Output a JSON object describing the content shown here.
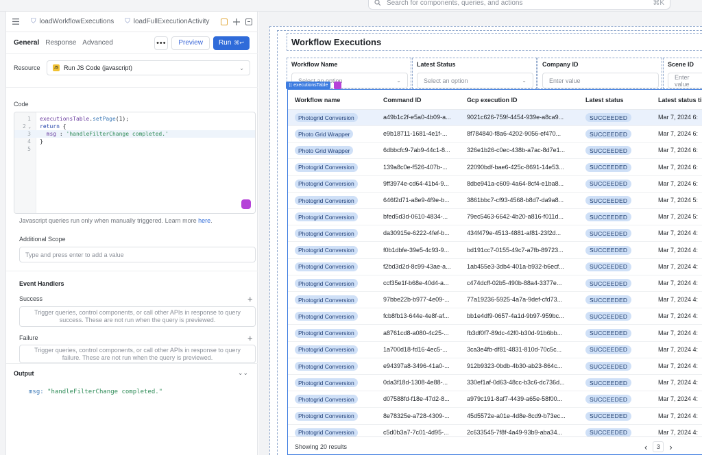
{
  "topbar": {
    "search_placeholder": "Search for components, queries, and actions",
    "search_shortcut": "⌘K"
  },
  "query_tabs": [
    {
      "label": "loadWorkflowExecutions"
    },
    {
      "label": "loadFullExecutionActivity"
    }
  ],
  "subtabs": {
    "general": "General",
    "response": "Response",
    "advanced": "Advanced",
    "more": "•••",
    "preview": "Preview",
    "run": "Run",
    "run_shortcut": "⌘↩"
  },
  "resource": {
    "label": "Resource",
    "value": "Run JS Code (javascript)",
    "badge": "JS"
  },
  "code": {
    "label": "Code",
    "lines": [
      {
        "n": "1",
        "text": "executionsTable.setPage(1);"
      },
      {
        "n": "2",
        "text": "return {"
      },
      {
        "n": "3",
        "text": "  msg : 'handleFilterChange completed.'"
      },
      {
        "n": "4",
        "text": "}"
      },
      {
        "n": "5",
        "text": ""
      }
    ]
  },
  "hint": {
    "text": "Javascript queries run only when manually triggered. Learn more ",
    "link": "here",
    "end": "."
  },
  "additional_scope": {
    "label": "Additional Scope",
    "placeholder": "Type and press enter to add a value"
  },
  "event_handlers": {
    "title": "Event Handlers",
    "success_label": "Success",
    "success_text": "Trigger queries, control components, or call other APIs in response to query success. These are not run when the query is previewed.",
    "failure_label": "Failure",
    "failure_text": "Trigger queries, control components, or call other APIs in response to query failure. These are not run when the query is previewed."
  },
  "output": {
    "label": "Output",
    "key": "msg:",
    "value": " \"handleFilterChange completed.\""
  },
  "canvas": {
    "title": "Workflow Executions",
    "table_tag": "executionsTable",
    "filters": [
      {
        "label": "Workflow Name",
        "placeholder": "Select an option",
        "type": "select"
      },
      {
        "label": "Latest Status",
        "placeholder": "Select an option",
        "type": "select"
      },
      {
        "label": "Company ID",
        "placeholder": "Enter value",
        "type": "input"
      },
      {
        "label": "Scene ID",
        "placeholder": "Enter value",
        "type": "input"
      }
    ],
    "columns": [
      "Workflow name",
      "Command ID",
      "Gcp execution ID",
      "Latest status",
      "Latest status ti"
    ],
    "rows": [
      {
        "workflow": "Photogrid Conversion",
        "command": "a49b1c2f-e5a0-4b09-a...",
        "gcp": "9021c626-759f-4454-939e-a8ca9...",
        "status": "SUCCEEDED",
        "time": "Mar 7, 2024 6:"
      },
      {
        "workflow": "Photo Grid Wrapper",
        "command": "e9b18711-1681-4e1f-...",
        "gcp": "8f784840-f8a6-4202-9056-ef470...",
        "status": "SUCCEEDED",
        "time": "Mar 7, 2024 6:"
      },
      {
        "workflow": "Photo Grid Wrapper",
        "command": "6dbbcfc9-7ab9-44c1-8...",
        "gcp": "326e1b26-c0ec-438b-a7ac-8d7e1...",
        "status": "SUCCEEDED",
        "time": "Mar 7, 2024 6:"
      },
      {
        "workflow": "Photogrid Conversion",
        "command": "139a8c0e-f526-407b-...",
        "gcp": "22090bdf-bae6-425c-8691-14e53...",
        "status": "SUCCEEDED",
        "time": "Mar 7, 2024 6:"
      },
      {
        "workflow": "Photogrid Conversion",
        "command": "9ff3974e-cd64-41b4-9...",
        "gcp": "8dbe941a-c609-4a64-8cf4-e1ba8...",
        "status": "SUCCEEDED",
        "time": "Mar 7, 2024 6:"
      },
      {
        "workflow": "Photogrid Conversion",
        "command": "646f2d71-a8e9-4f9e-b...",
        "gcp": "3861bbc7-cf93-4568-b8d7-da9a8...",
        "status": "SUCCEEDED",
        "time": "Mar 7, 2024 5:"
      },
      {
        "workflow": "Photogrid Conversion",
        "command": "bfed5d3d-0610-4834-...",
        "gcp": "79ec5463-6642-4b20-a816-f011d...",
        "status": "SUCCEEDED",
        "time": "Mar 7, 2024 5:"
      },
      {
        "workflow": "Photogrid Conversion",
        "command": "da30915e-6222-4fef-b...",
        "gcp": "434f479e-4513-4881-af81-23f2d...",
        "status": "SUCCEEDED",
        "time": "Mar 7, 2024 4:"
      },
      {
        "workflow": "Photogrid Conversion",
        "command": "f0b1dbfe-39e5-4c93-9...",
        "gcp": "bd191cc7-0155-49c7-a7fb-89723...",
        "status": "SUCCEEDED",
        "time": "Mar 7, 2024 4:"
      },
      {
        "workflow": "Photogrid Conversion",
        "command": "f2bd3d2d-8c99-43ae-a...",
        "gcp": "1ab455e3-3db4-401a-b932-b6ecf...",
        "status": "SUCCEEDED",
        "time": "Mar 7, 2024 4:"
      },
      {
        "workflow": "Photogrid Conversion",
        "command": "ccf35e1f-b68e-40d4-a...",
        "gcp": "c474dcff-02b5-490b-88a4-3377e...",
        "status": "SUCCEEDED",
        "time": "Mar 7, 2024 4:"
      },
      {
        "workflow": "Photogrid Conversion",
        "command": "97bbe22b-b977-4e09-...",
        "gcp": "77a19236-5925-4a7a-9def-cfd73...",
        "status": "SUCCEEDED",
        "time": "Mar 7, 2024 4:"
      },
      {
        "workflow": "Photogrid Conversion",
        "command": "fcb8fb13-644e-4e8f-af...",
        "gcp": "bb1e4df9-0657-4a1d-9b97-959bc...",
        "status": "SUCCEEDED",
        "time": "Mar 7, 2024 4:"
      },
      {
        "workflow": "Photogrid Conversion",
        "command": "a8761cd8-a080-4c25-...",
        "gcp": "fb3df0f7-89dc-42f0-b30d-91b6bb...",
        "status": "SUCCEEDED",
        "time": "Mar 7, 2024 4:"
      },
      {
        "workflow": "Photogrid Conversion",
        "command": "1a700d18-fd16-4ec5-...",
        "gcp": "3ca3e4fb-df81-4831-810d-70c5c...",
        "status": "SUCCEEDED",
        "time": "Mar 7, 2024 4:"
      },
      {
        "workflow": "Photogrid Conversion",
        "command": "e94397a8-3496-41a0-...",
        "gcp": "912b9323-0bdb-4b30-ab23-864c...",
        "status": "SUCCEEDED",
        "time": "Mar 7, 2024 4:"
      },
      {
        "workflow": "Photogrid Conversion",
        "command": "0da3f18d-1308-4e88-...",
        "gcp": "330ef1af-0d63-48cc-b3c6-dc736d...",
        "status": "SUCCEEDED",
        "time": "Mar 7, 2024 4:"
      },
      {
        "workflow": "Photogrid Conversion",
        "command": "d07588fd-f18e-47d2-8...",
        "gcp": "a979c191-8af7-4439-a65e-58f00...",
        "status": "SUCCEEDED",
        "time": "Mar 7, 2024 4:"
      },
      {
        "workflow": "Photogrid Conversion",
        "command": "8e78325e-a728-4309-...",
        "gcp": "45d5572e-a01e-4d8e-8cd9-b73ec...",
        "status": "SUCCEEDED",
        "time": "Mar 7, 2024 4:"
      },
      {
        "workflow": "Photogrid Conversion",
        "command": "c5d0b3a7-7c01-4d95-...",
        "gcp": "2c633545-7f8f-4a49-93b9-aba34...",
        "status": "SUCCEEDED",
        "time": "Mar 7, 2024 4:"
      }
    ],
    "footer": {
      "showing": "Showing 20 results",
      "page": "3",
      "prev": "‹",
      "next": "›"
    }
  },
  "colors": {
    "accent": "#2f6bd9",
    "pill_bg": "#cfe0f7",
    "selection": "#3d7ce0"
  }
}
